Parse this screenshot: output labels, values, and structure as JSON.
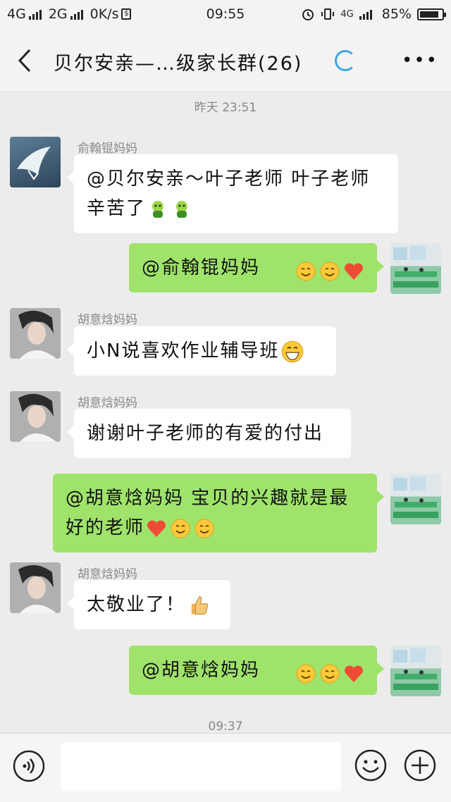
{
  "status_bar": {
    "network1": "4G",
    "network2": "2G",
    "speed": "0K/s",
    "time": "09:55",
    "network3": "4G",
    "battery": "85%",
    "battery_level": 0.85
  },
  "header": {
    "title": "贝尔安亲—…级家长群(26)"
  },
  "timestamps": {
    "first": "昨天 23:51",
    "last": "09:37"
  },
  "messages": [
    {
      "sender": "俞翰锟妈妈",
      "text": "@贝尔安亲～叶子老师 叶子老师辛苦了",
      "emojis": [
        "frog-emoji",
        "frog-emoji"
      ]
    },
    {
      "text": "@俞翰锟妈妈",
      "emojis": [
        "smile-emoji",
        "smile-emoji",
        "heart-emoji"
      ]
    },
    {
      "sender": "胡意焓妈妈",
      "text": "小N说喜欢作业辅导班",
      "emojis": [
        "grin-emoji"
      ]
    },
    {
      "sender": "胡意焓妈妈",
      "text": "谢谢叶子老师的有爱的付出",
      "emojis": []
    },
    {
      "text": "@胡意焓妈妈 宝贝的兴趣就是最好的老师",
      "emojis": [
        "heart-emoji",
        "smile-emoji",
        "smile-emoji"
      ]
    },
    {
      "sender": "胡意焓妈妈",
      "text": "太敬业了！",
      "emojis": [
        "thumbs-up-emoji"
      ]
    },
    {
      "text": "@胡意焓妈妈",
      "emojis": [
        "smile-emoji",
        "smile-emoji",
        "heart-emoji"
      ]
    }
  ],
  "input": {
    "placeholder": ""
  },
  "colors": {
    "outgoing_bubble": "#9fe36b",
    "incoming_bubble": "#ffffff",
    "background": "#ececec",
    "spinner": "#3fa7e1"
  }
}
